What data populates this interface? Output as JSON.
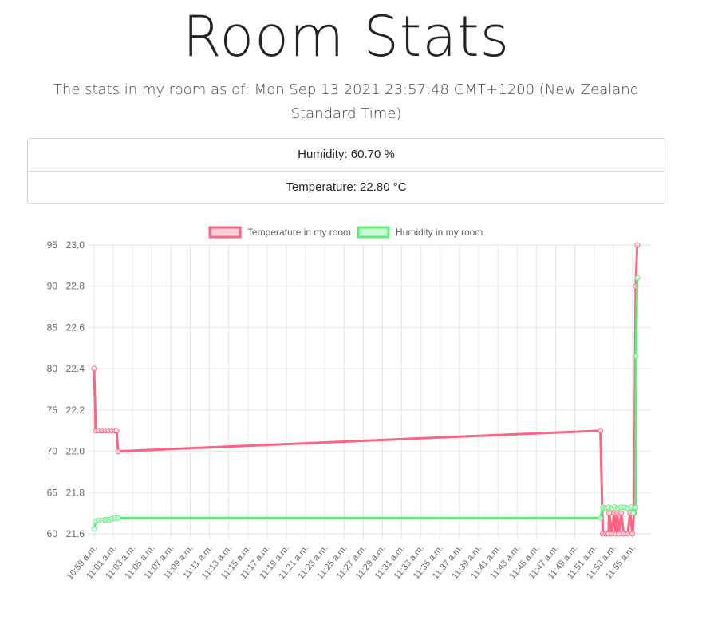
{
  "page": {
    "title": "Room Stats",
    "subtitle": "The stats in my room as of: Mon Sep 13 2021 23:57:48 GMT+1200 (New Zealand Standard Time)"
  },
  "stats": [
    {
      "label": "Humidity: 60.70 %"
    },
    {
      "label": "Temperature: 22.80 °C"
    }
  ],
  "colors": {
    "temperature": "#ff6384",
    "humidity": "#5af078",
    "grid": "#e6e6e6",
    "tick": "#666666"
  },
  "chart_data": {
    "type": "line",
    "legend_position": "top",
    "grid": true,
    "x_ticks": [
      "10:59 a.m.",
      "11:01 a.m.",
      "11:03 a.m.",
      "11:05 a.m.",
      "11:07 a.m.",
      "11:09 a.m.",
      "11:11 a.m.",
      "11:13 a.m.",
      "11:15 a.m.",
      "11:17 a.m.",
      "11:19 a.m.",
      "11:21 a.m.",
      "11:23 a.m.",
      "11:25 a.m.",
      "11:27 a.m.",
      "11:29 a.m.",
      "11:31 a.m.",
      "11:33 a.m.",
      "11:35 a.m.",
      "11:37 a.m.",
      "11:39 a.m.",
      "11:41 a.m.",
      "11:43 a.m.",
      "11:45 a.m.",
      "11:47 a.m.",
      "11:49 a.m.",
      "11:51 a.m.",
      "11:53 a.m.",
      "11:55 a.m."
    ],
    "y_left": {
      "ticks": [
        "60",
        "65",
        "70",
        "75",
        "80",
        "85",
        "90",
        "95"
      ],
      "range": [
        60,
        95
      ]
    },
    "y_right": {
      "ticks": [
        "21.6",
        "21.8",
        "22.0",
        "22.2",
        "22.4",
        "22.6",
        "22.8",
        "23.0"
      ],
      "range": [
        21.6,
        23.0
      ]
    },
    "series": [
      {
        "name": "Temperature in my room",
        "axis": "right",
        "points": [
          [
            "10:59:00",
            22.4
          ],
          [
            "10:59:10",
            22.1
          ],
          [
            "10:59:30",
            22.1
          ],
          [
            "10:59:50",
            22.1
          ],
          [
            "11:00:10",
            22.1
          ],
          [
            "11:00:30",
            22.1
          ],
          [
            "11:00:50",
            22.1
          ],
          [
            "11:01:10",
            22.1
          ],
          [
            "11:01:20",
            22.1
          ],
          [
            "11:01:30",
            22.0
          ],
          [
            "11:51:40",
            22.1
          ],
          [
            "11:51:55",
            21.6
          ],
          [
            "11:52:15",
            21.6
          ],
          [
            "11:52:30",
            21.6
          ],
          [
            "11:52:35",
            21.7
          ],
          [
            "11:52:50",
            21.6
          ],
          [
            "11:53:05",
            21.7
          ],
          [
            "11:53:15",
            21.6
          ],
          [
            "11:53:25",
            21.7
          ],
          [
            "11:53:35",
            21.6
          ],
          [
            "11:53:50",
            21.7
          ],
          [
            "11:54:05",
            21.6
          ],
          [
            "11:54:30",
            21.6
          ],
          [
            "11:54:45",
            21.7
          ],
          [
            "11:55:00",
            21.6
          ],
          [
            "11:55:10",
            21.7
          ],
          [
            "11:55:20",
            22.8
          ],
          [
            "11:55:30",
            23.0
          ]
        ]
      },
      {
        "name": "Humidity in my room",
        "axis": "left",
        "points": [
          [
            "10:59:00",
            60.6
          ],
          [
            "10:59:10",
            61.5
          ],
          [
            "10:59:30",
            61.6
          ],
          [
            "10:59:50",
            61.6
          ],
          [
            "11:00:10",
            61.7
          ],
          [
            "11:00:30",
            61.7
          ],
          [
            "11:00:50",
            61.8
          ],
          [
            "11:01:10",
            61.9
          ],
          [
            "11:01:30",
            61.9
          ],
          [
            "11:51:40",
            61.9
          ],
          [
            "11:51:55",
            63.2
          ],
          [
            "11:52:15",
            63.1
          ],
          [
            "11:52:30",
            63.2
          ],
          [
            "11:52:50",
            63.1
          ],
          [
            "11:53:10",
            63.2
          ],
          [
            "11:53:30",
            63.1
          ],
          [
            "11:53:50",
            63.2
          ],
          [
            "11:54:10",
            63.2
          ],
          [
            "11:54:30",
            63.1
          ],
          [
            "11:54:50",
            63.2
          ],
          [
            "11:55:05",
            62.5
          ],
          [
            "11:55:15",
            63.1
          ],
          [
            "11:55:20",
            63.2
          ],
          [
            "11:55:22",
            81.5
          ],
          [
            "11:55:30",
            91.0
          ]
        ]
      }
    ]
  }
}
